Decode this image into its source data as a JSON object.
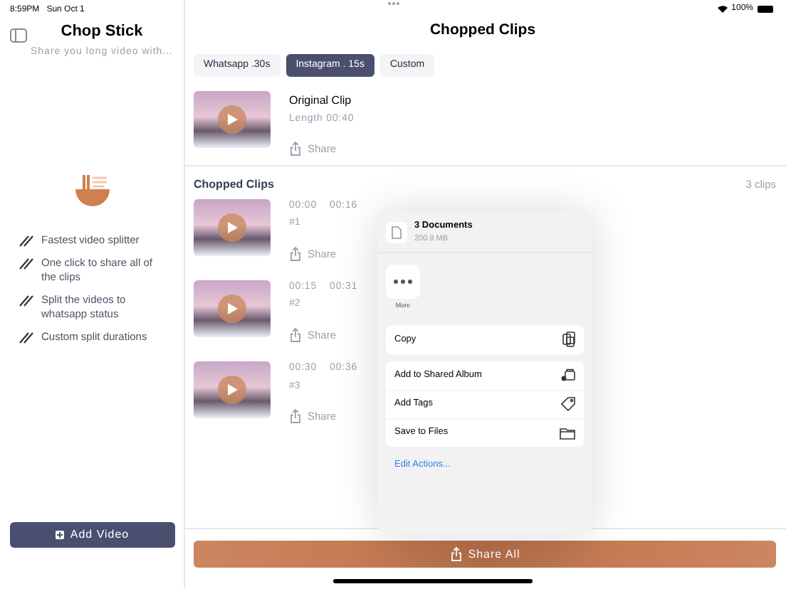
{
  "status_bar": {
    "time": "8:59PM",
    "date": "Sun Oct 1",
    "battery": "100%"
  },
  "sidebar": {
    "title": "Chop Stick",
    "subtitle": "Share you long video with...",
    "features": [
      "Fastest video splitter",
      "One click to share all of the clips",
      "Split the videos to whatsapp status",
      "Custom split durations"
    ],
    "add_button": "Add Video"
  },
  "main": {
    "title": "Chopped Clips",
    "tabs": [
      {
        "label": "Whatsapp .30s",
        "selected": false
      },
      {
        "label": "Instagram . 15s",
        "selected": true
      },
      {
        "label": "Custom",
        "selected": false
      }
    ],
    "original": {
      "title": "Original Clip",
      "length": "Length 00:40",
      "share": "Share"
    },
    "section": {
      "title": "Chopped Clips",
      "count": "3 clips"
    },
    "clips": [
      {
        "start": "00:00",
        "end": "00:16",
        "number": "#1",
        "share": "Share"
      },
      {
        "start": "00:15",
        "end": "00:31",
        "number": "#2",
        "share": "Share"
      },
      {
        "start": "00:30",
        "end": "00:36",
        "number": "#3",
        "share": "Share"
      }
    ],
    "share_all": "Share All"
  },
  "share_sheet": {
    "title": "3 Documents",
    "size": "200.9 MB",
    "app": "More",
    "groups": [
      [
        "Copy"
      ],
      [
        "Add to Shared Album",
        "Add Tags",
        "Save to Files"
      ]
    ],
    "edit": "Edit Actions..."
  }
}
